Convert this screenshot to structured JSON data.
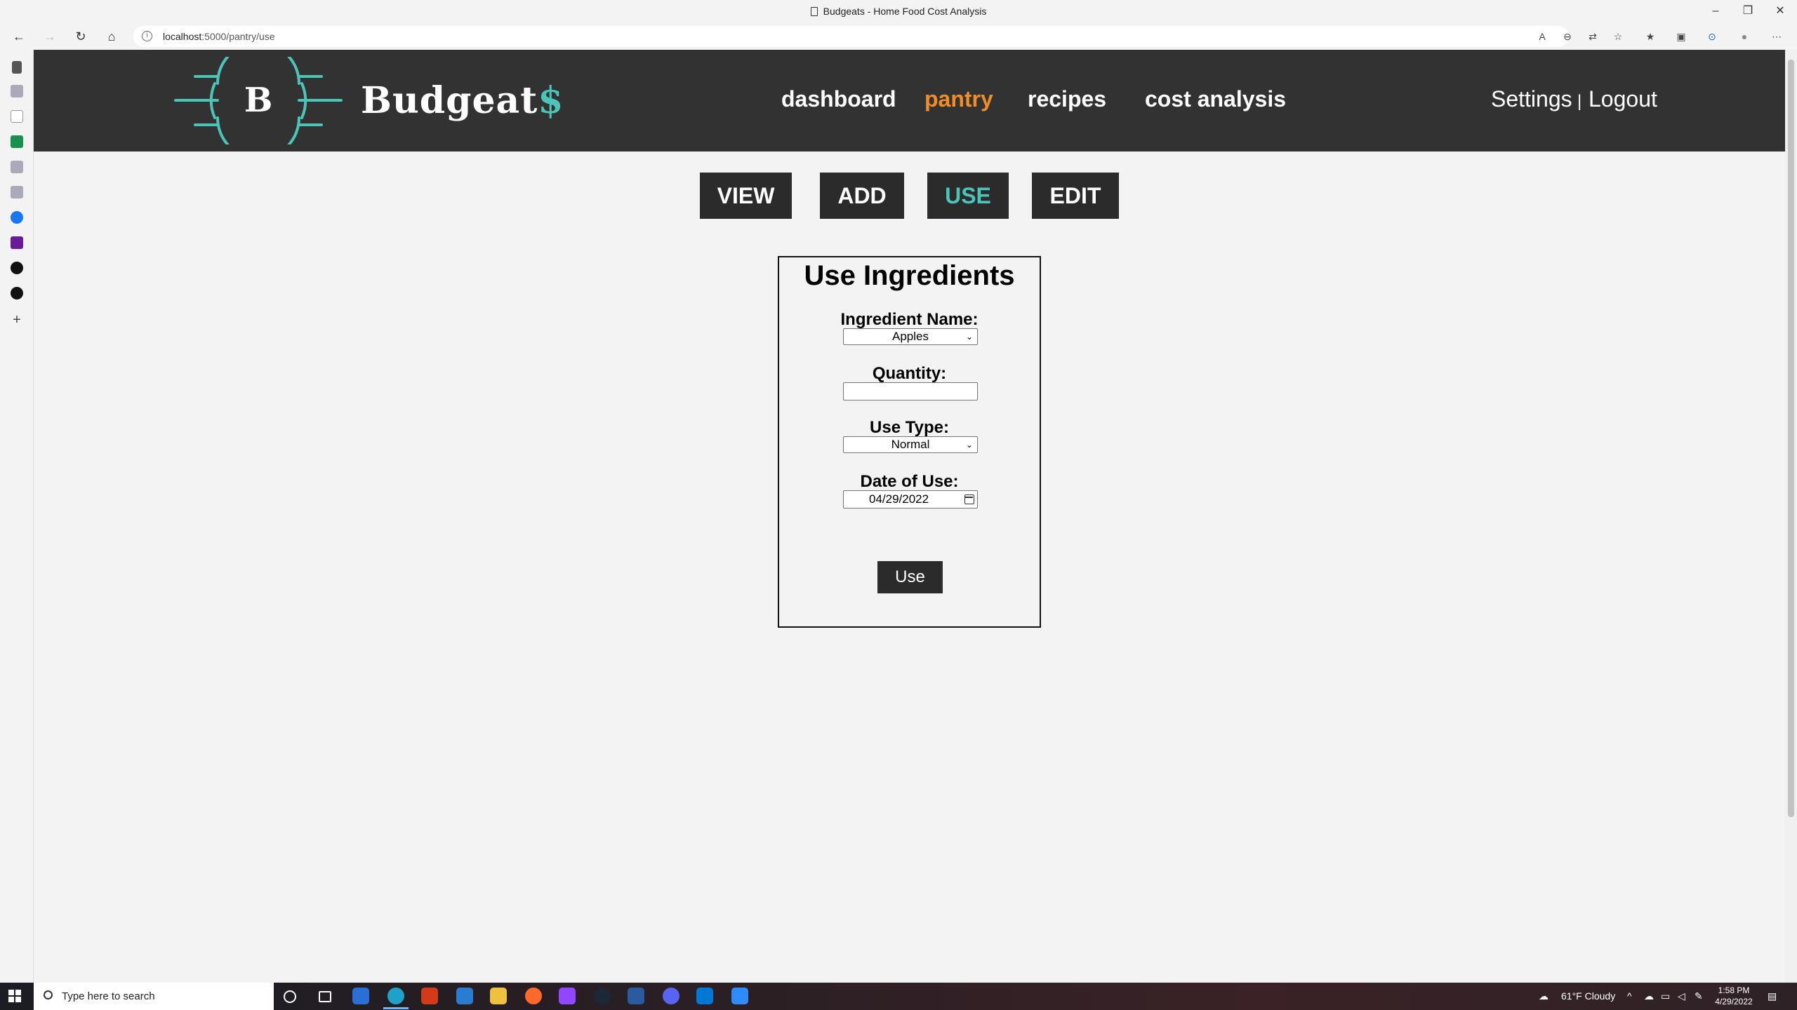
{
  "browser": {
    "window_title": "Budgeats - Home Food Cost Analysis",
    "url_host": "localhost",
    "url_path": ":5000/pantry/use"
  },
  "site": {
    "brand_text": "Budgeat",
    "brand_suffix": "$",
    "logo_letter": "B",
    "nav": [
      "dashboard",
      "pantry",
      "recipes",
      "cost analysis"
    ],
    "active_nav": "pantry",
    "settings_label": "Settings",
    "separator": "|",
    "logout_label": "Logout",
    "accent_color": "#4cc5b8",
    "active_color": "#f28c28"
  },
  "subtabs": [
    "VIEW",
    "ADD",
    "USE",
    "EDIT"
  ],
  "form": {
    "title": "Use Ingredients",
    "ingredient_label": "Ingredient Name:",
    "ingredient_value": "Apples",
    "quantity_label": "Quantity:",
    "quantity_value": "",
    "use_type_label": "Use Type:",
    "use_type_value": "Normal",
    "date_label": "Date of Use:",
    "date_value": "04/29/2022",
    "submit_label": "Use"
  },
  "taskbar": {
    "search_placeholder": "Type here to search",
    "weather": "61°F  Cloudy",
    "time": "1:58 PM",
    "date": "4/29/2022"
  }
}
